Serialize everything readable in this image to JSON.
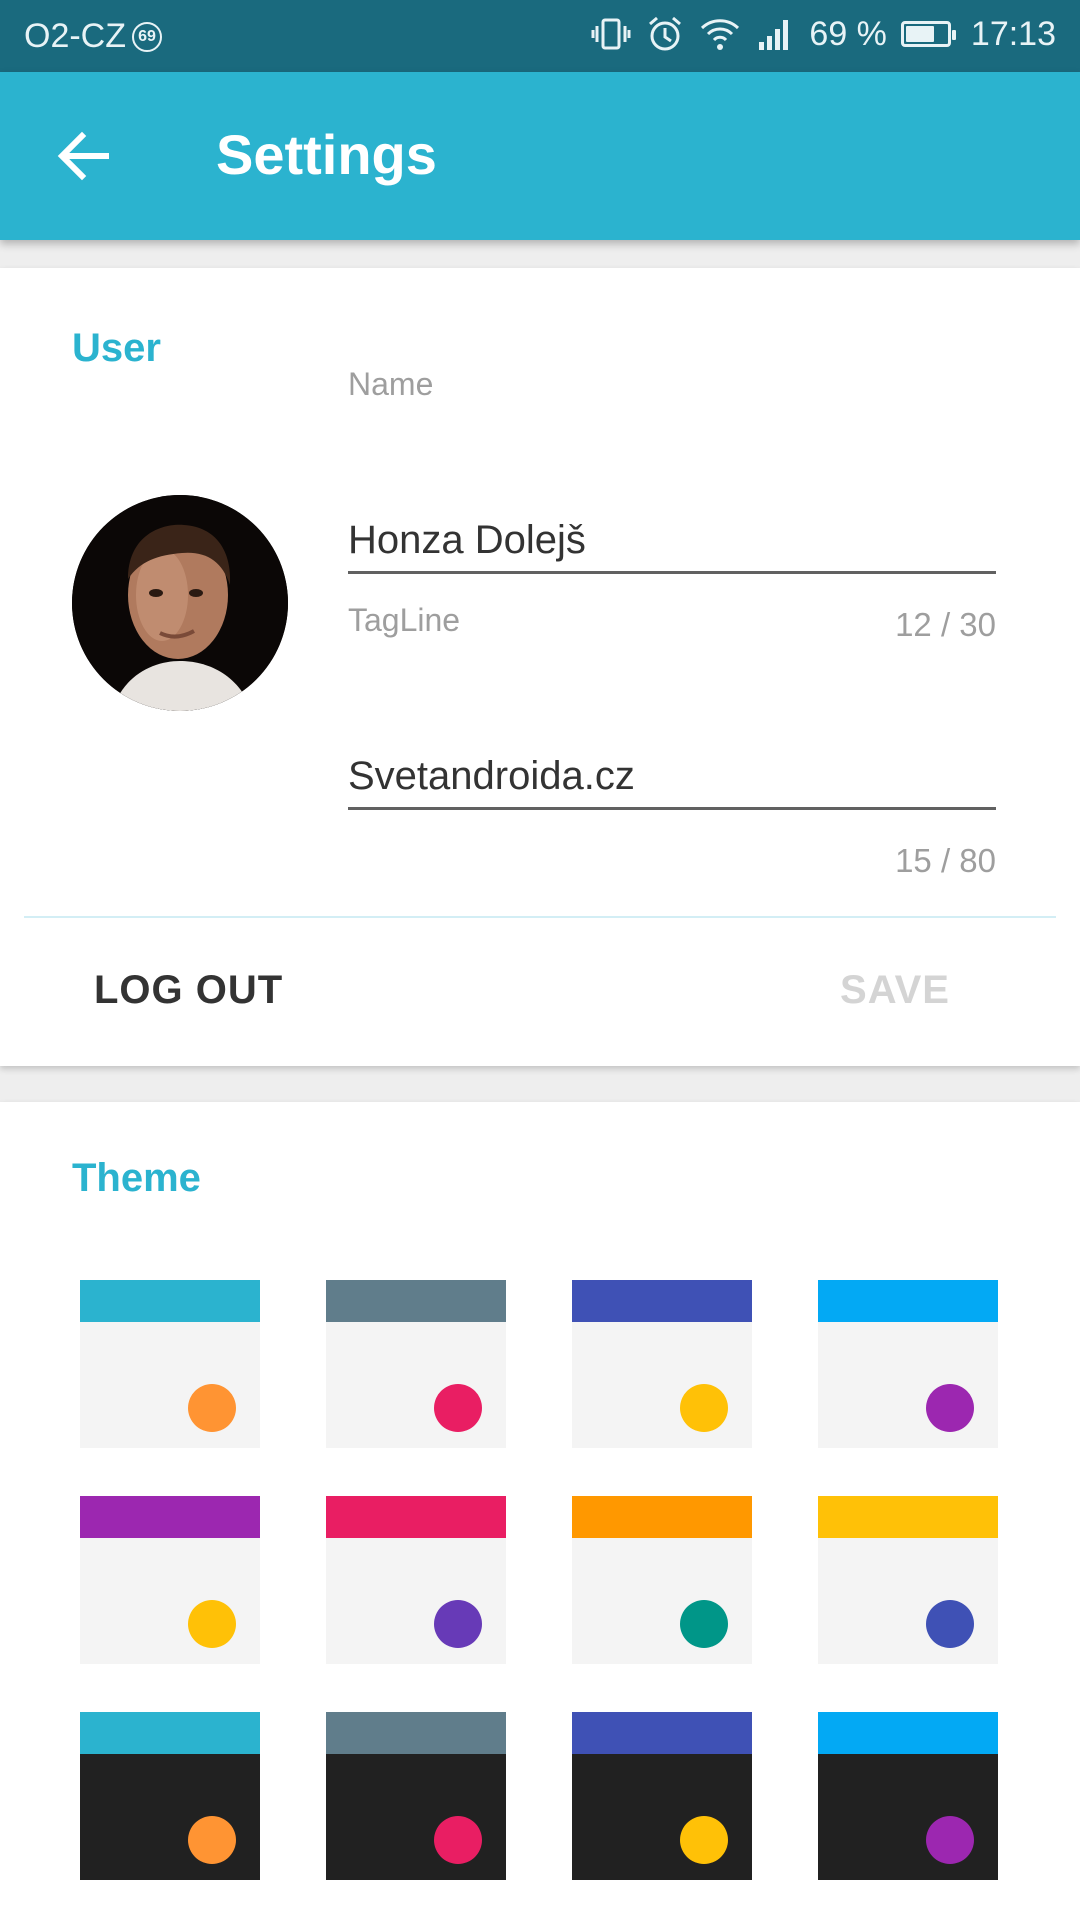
{
  "status_bar": {
    "carrier": "O2-CZ",
    "carrier_badge": "69",
    "battery": "69 %",
    "battery_level": 0.69,
    "time": "17:13",
    "icons": [
      "vibrate-icon",
      "alarm-icon",
      "wifi-icon",
      "signal-icon",
      "battery-icon"
    ]
  },
  "app_bar": {
    "title": "Settings",
    "back_icon": "arrow-back-icon",
    "color": "#2bb3cf"
  },
  "user_section": {
    "title": "User",
    "avatar_icon": "avatar-photo",
    "name_field": {
      "label": "Name",
      "value": "Honza Dolejš",
      "counter": "12 / 30"
    },
    "tagline_field": {
      "label": "TagLine",
      "value": "Svetandroida.cz",
      "counter": "15 / 80"
    },
    "logout_label": "LOG OUT",
    "save_label": "SAVE"
  },
  "theme_section": {
    "title": "Theme",
    "themes": [
      {
        "primary": "#2bb3cf",
        "accent": "#ff9433",
        "background": "#f4f4f4"
      },
      {
        "primary": "#607d8b",
        "accent": "#e91e63",
        "background": "#f4f4f4"
      },
      {
        "primary": "#3f51b5",
        "accent": "#ffc107",
        "background": "#f4f4f4"
      },
      {
        "primary": "#03a9f4",
        "accent": "#9c27b0",
        "background": "#f4f4f4"
      },
      {
        "primary": "#9c27b0",
        "accent": "#ffc107",
        "background": "#f4f4f4"
      },
      {
        "primary": "#e91e63",
        "accent": "#673ab7",
        "background": "#f4f4f4"
      },
      {
        "primary": "#ff9800",
        "accent": "#009688",
        "background": "#f4f4f4"
      },
      {
        "primary": "#ffc107",
        "accent": "#3f51b5",
        "background": "#f4f4f4"
      },
      {
        "primary": "#2bb3cf",
        "accent": "#ff9433",
        "background": "#212121"
      },
      {
        "primary": "#607d8b",
        "accent": "#e91e63",
        "background": "#212121"
      },
      {
        "primary": "#3f51b5",
        "accent": "#ffc107",
        "background": "#212121"
      },
      {
        "primary": "#03a9f4",
        "accent": "#9c27b0",
        "background": "#212121"
      }
    ]
  }
}
